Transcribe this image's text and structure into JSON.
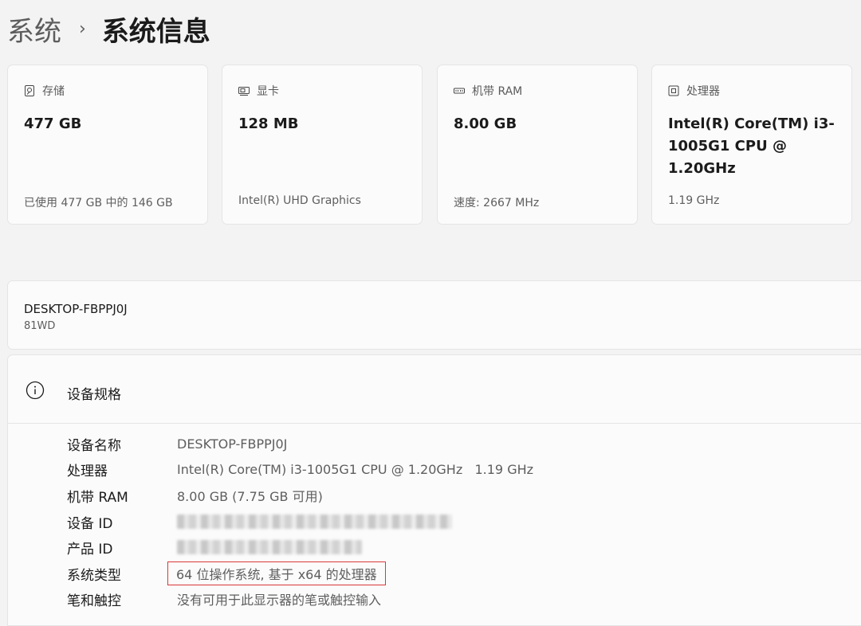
{
  "breadcrumb": {
    "parent": "系统",
    "separator": "›",
    "current": "系统信息"
  },
  "cards": [
    {
      "icon": "storage-icon",
      "title": "存储",
      "value": "477 GB",
      "sub": "已使用 477 GB 中的 146 GB"
    },
    {
      "icon": "display-adapter-icon",
      "title": "显卡",
      "value": "128 MB",
      "sub": "Intel(R) UHD Graphics"
    },
    {
      "icon": "memory-icon",
      "title": "机带 RAM",
      "value": "8.00 GB",
      "sub": "速度: 2667 MHz"
    },
    {
      "icon": "processor-icon",
      "title": "处理器",
      "value": "Intel(R) Core(TM) i3-1005G1 CPU @ 1.20GHz",
      "sub": "1.19 GHz"
    }
  ],
  "device": {
    "name": "DESKTOP-FBPPJ0J",
    "model": "81WD"
  },
  "specs": {
    "title": "设备规格",
    "rows": [
      {
        "label": "设备名称",
        "value": "DESKTOP-FBPPJ0J"
      },
      {
        "label": "处理器",
        "value": "Intel(R) Core(TM) i3-1005G1 CPU @ 1.20GHz   1.19 GHz"
      },
      {
        "label": "机带 RAM",
        "value": "8.00 GB (7.75 GB 可用)"
      },
      {
        "label": "设备 ID",
        "value": ""
      },
      {
        "label": "产品 ID",
        "value": ""
      },
      {
        "label": "系统类型",
        "value": "64 位操作系统, 基于 x64 的处理器"
      },
      {
        "label": "笔和触控",
        "value": "没有可用于此显示器的笔或触控输入"
      }
    ]
  },
  "colors": {
    "highlight": "#d93838"
  }
}
